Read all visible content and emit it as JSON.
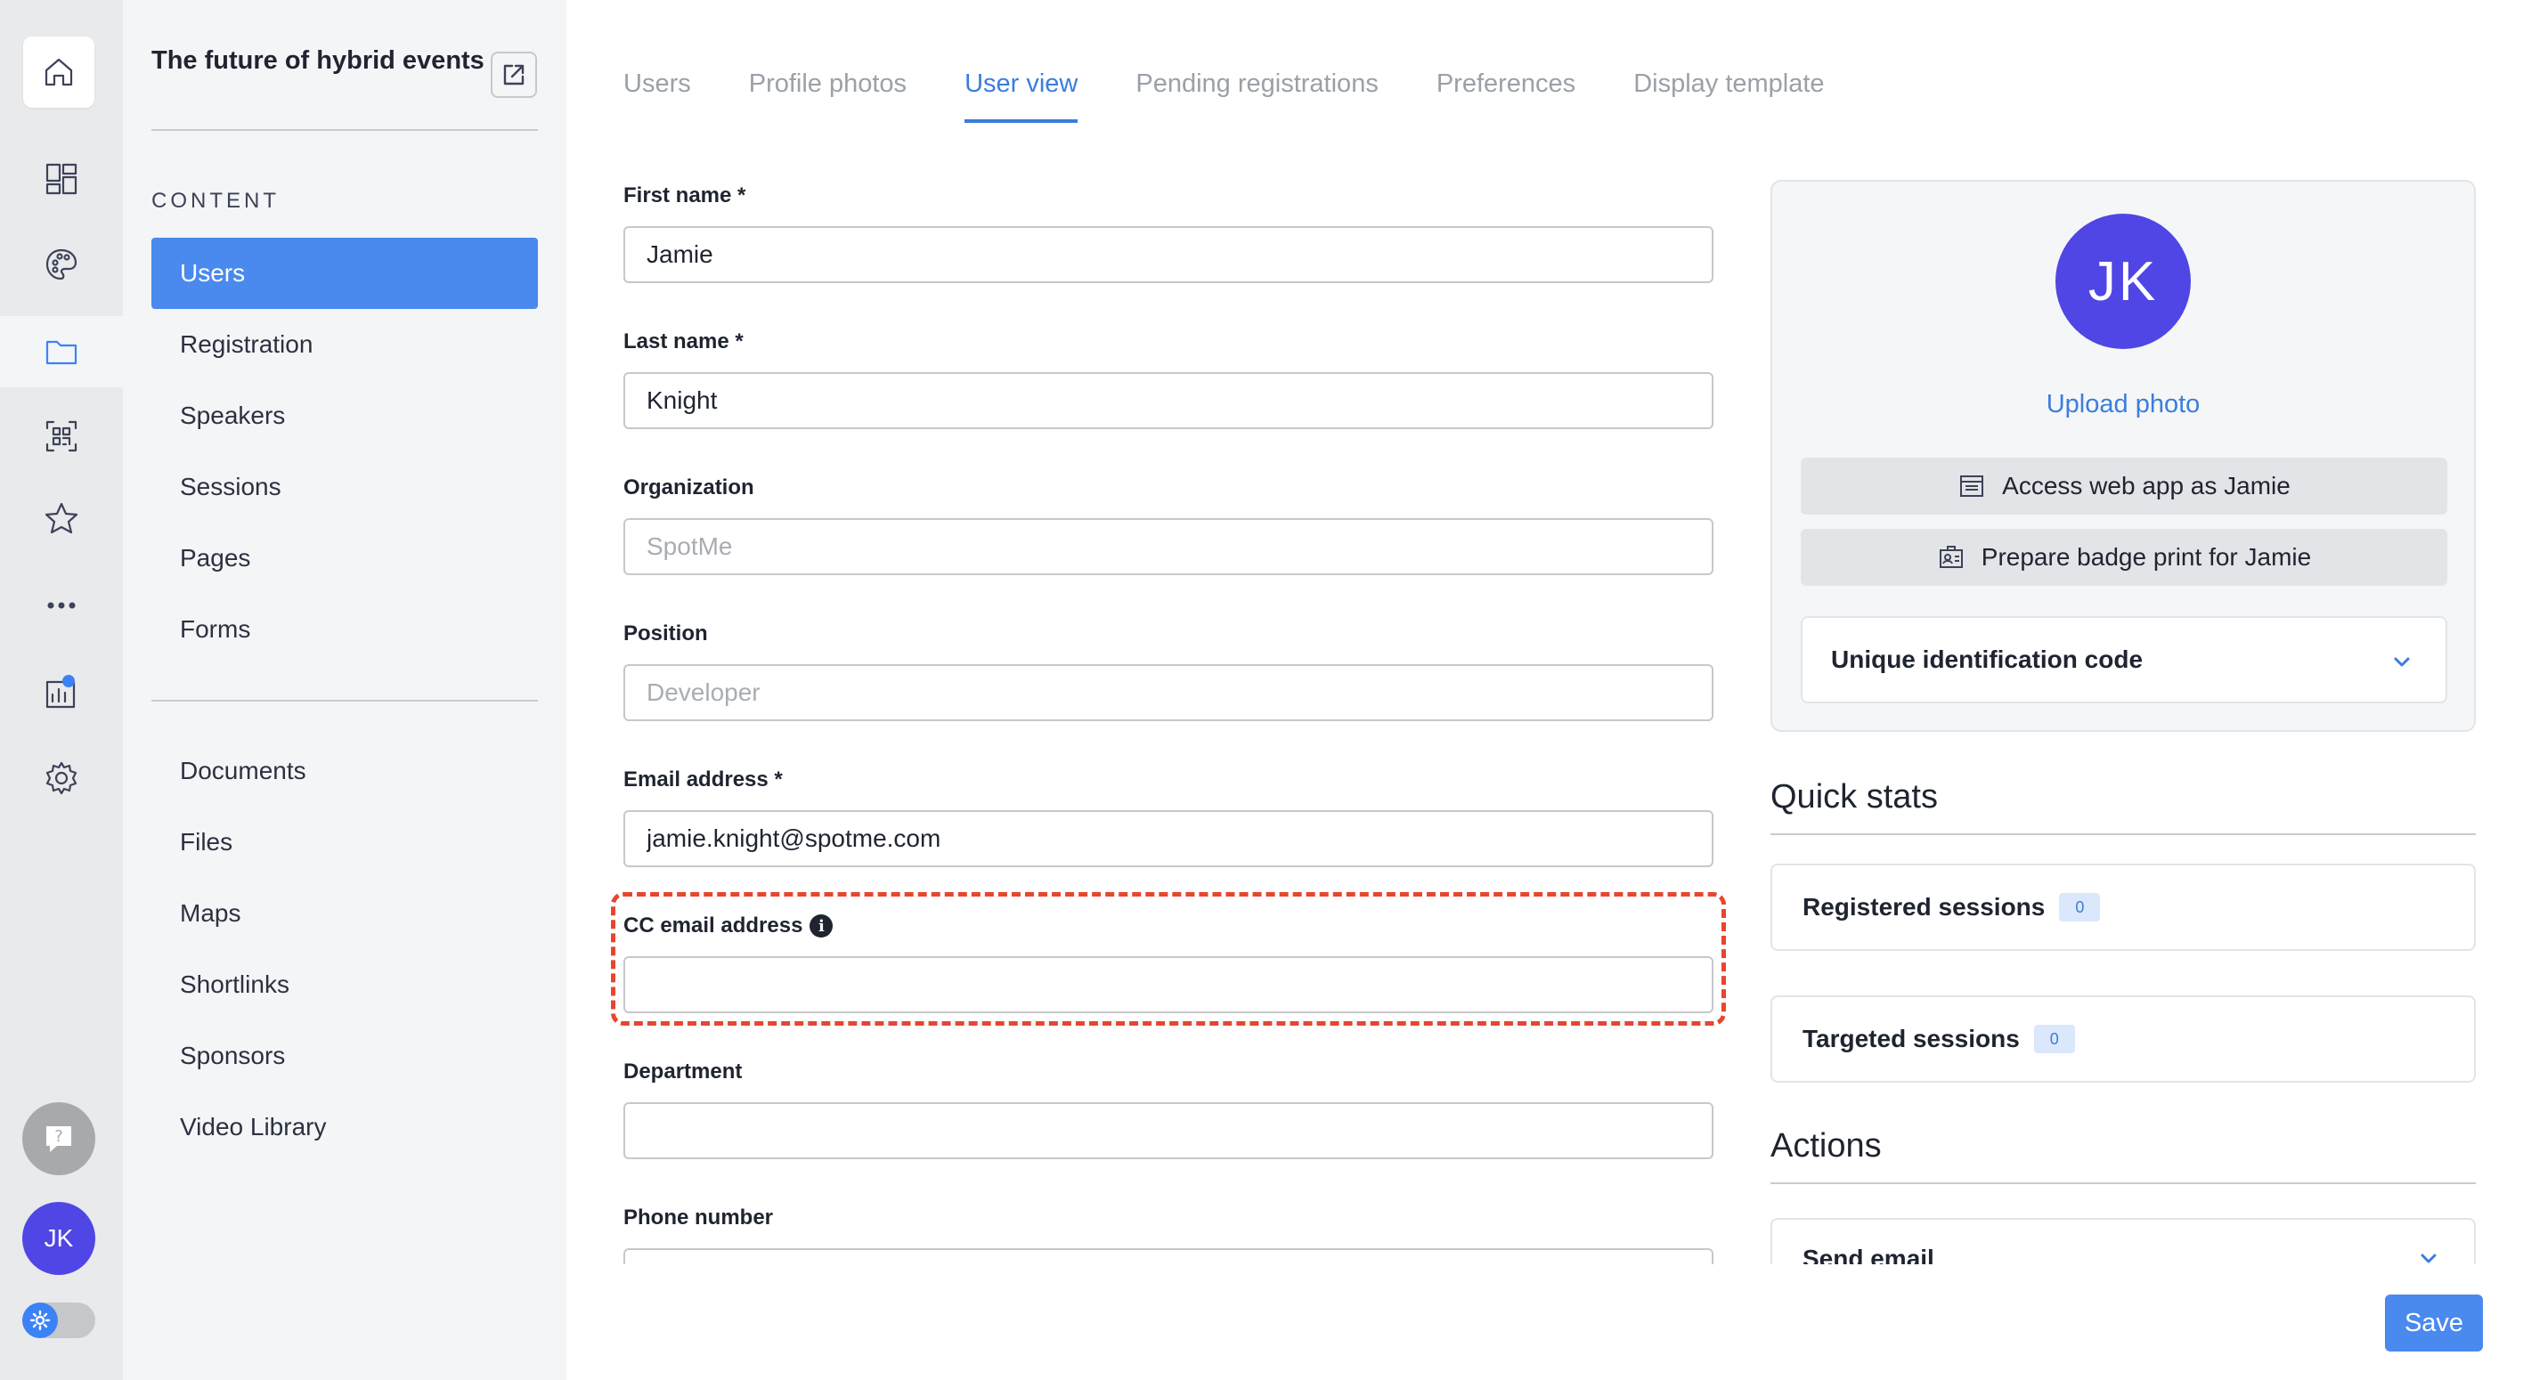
{
  "rail": {
    "items": [
      {
        "icon": "home-icon"
      },
      {
        "icon": "dashboard-icon"
      },
      {
        "icon": "palette-icon"
      },
      {
        "icon": "folder-icon",
        "active": true
      },
      {
        "icon": "qr-scan-icon"
      },
      {
        "icon": "star-icon"
      },
      {
        "icon": "more-icon"
      },
      {
        "icon": "analytics-icon"
      },
      {
        "icon": "gear-icon"
      }
    ],
    "avatar_initials": "JK",
    "accent_color": "#3b82f6"
  },
  "sidebar": {
    "event_title": "The future of hybrid events",
    "section_label": "CONTENT",
    "items": [
      {
        "label": "Users",
        "active": true
      },
      {
        "label": "Registration"
      },
      {
        "label": "Speakers"
      },
      {
        "label": "Sessions"
      },
      {
        "label": "Pages"
      },
      {
        "label": "Forms"
      }
    ],
    "items2": [
      {
        "label": "Documents"
      },
      {
        "label": "Files"
      },
      {
        "label": "Maps"
      },
      {
        "label": "Shortlinks"
      },
      {
        "label": "Sponsors"
      },
      {
        "label": "Video Library"
      }
    ]
  },
  "tabs": [
    {
      "label": "Users"
    },
    {
      "label": "Profile photos"
    },
    {
      "label": "User view",
      "active": true
    },
    {
      "label": "Pending registrations"
    },
    {
      "label": "Preferences"
    },
    {
      "label": "Display template"
    }
  ],
  "form": {
    "first_name": {
      "label": "First name *",
      "value": "Jamie"
    },
    "last_name": {
      "label": "Last name *",
      "value": "Knight"
    },
    "organization": {
      "label": "Organization",
      "placeholder": "SpotMe"
    },
    "position": {
      "label": "Position",
      "placeholder": "Developer"
    },
    "email": {
      "label": "Email address *",
      "value": "jamie.knight@spotme.com"
    },
    "cc_email": {
      "label": "CC email address",
      "value": ""
    },
    "department": {
      "label": "Department",
      "value": ""
    },
    "phone": {
      "label": "Phone number"
    }
  },
  "profile": {
    "initials": "JK",
    "upload_label": "Upload photo",
    "access_label": "Access web app as Jamie",
    "badge_label": "Prepare badge print for Jamie",
    "uid_label": "Unique identification code"
  },
  "quick_stats": {
    "heading": "Quick stats",
    "registered": {
      "label": "Registered sessions",
      "count": "0"
    },
    "targeted": {
      "label": "Targeted sessions",
      "count": "0"
    }
  },
  "actions": {
    "heading": "Actions",
    "send_email": "Send email"
  },
  "save_label": "Save",
  "colors": {
    "primary": "#4a89ee",
    "highlight": "#e8452f",
    "avatar": "#4f46e5"
  }
}
